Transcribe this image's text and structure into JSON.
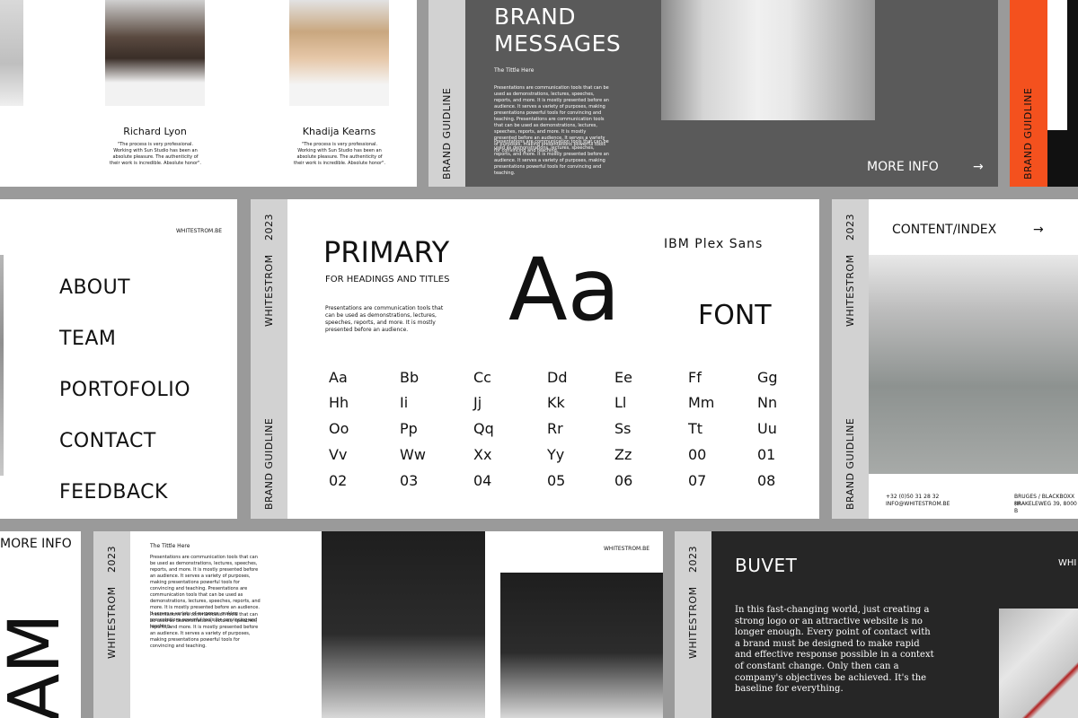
{
  "team_slide": {
    "members": [
      {
        "name": "Richard Lyon",
        "quote": "\"The process is very professional. Working with Sun Studio has been an absolute pleasure. The authenticity of their work is incredible. Absolute honor\"."
      },
      {
        "name": "Khadija Kearns",
        "quote": "\"The process is very professional. Working with Sun Studio has been an absolute pleasure. The authenticity of their work is incredible. Absolute honor\"."
      }
    ]
  },
  "brand_messages_slide": {
    "side_label": "BRAND GUIDLINE",
    "title_line1": "BRAND",
    "title_line2": "MESSAGES",
    "subtitle": "The Tittle Here",
    "para1": "Presentations are communication tools that can be used as demonstrations, lectures, speeches, reports, and more. It is mostly presented before an audience. It serves a variety of purposes, making presentations powerful tools for convincing and teaching. Presentations are communication tools that can be used as demonstrations, lectures, speeches, reports, and more. It is mostly presented before an audience. It serves a variety of purposes, making presentations powerful tools for convincing and teaching.",
    "para2": "Presentations are communication tools that can be used as demonstrations, lectures, speeches, reports, and more. It is mostly presented before an audience. It serves a variety of purposes, making presentations powerful tools for convincing and teaching.",
    "more_info": "MORE INFO",
    "arrow": "→"
  },
  "orange_slide": {
    "side_label": "BRAND GUIDLINE",
    "accent": "#f4511e"
  },
  "menu_slide": {
    "website": "WHITESTROM.BE",
    "items": [
      "ABOUT",
      "TEAM",
      "PORTOFOLIO",
      "CONTACT",
      "FEEDBACK"
    ]
  },
  "font_slide": {
    "year": "2023",
    "brand": "WHITESTROM",
    "side_label": "BRAND GUIDLINE",
    "primary": "PRIMARY",
    "sub": "FOR HEADINGS AND TITLES",
    "desc": "Presentations are communication tools that can be used as demonstrations, lectures, speeches, reports, and more. It is mostly presented before an audience.",
    "sample": "Aa",
    "font_name": "IBM Plex Sans",
    "font_word": "FONT",
    "glyph_rows": [
      [
        "Aa",
        "Bb",
        "Cc",
        "Dd",
        "Ee",
        "Ff",
        "Gg"
      ],
      [
        "Hh",
        "Ii",
        "Jj",
        "Kk",
        "Ll",
        "Mm",
        "Nn"
      ],
      [
        "Oo",
        "Pp",
        "Qq",
        "Rr",
        "Ss",
        "Tt",
        "Uu"
      ],
      [
        "Vv",
        "Ww",
        "Xx",
        "Yy",
        "Zz",
        "00",
        "01"
      ],
      [
        "02",
        "03",
        "04",
        "05",
        "06",
        "07",
        "08"
      ]
    ]
  },
  "index_slide": {
    "year": "2023",
    "brand": "WHITESTROM",
    "side_label": "BRAND GUIDLINE",
    "title": "CONTENT/INDEX",
    "arrow": "→",
    "phone": "+32 (0)50 31 28 32",
    "email": "INFO@WHITESTROM.BE",
    "address1": "BRUGES / BLACKBOXX (H",
    "address2": "KRAKELEWEG 39, 8000 B"
  },
  "bottom_left_slide": {
    "more_info": "MORE INFO",
    "big_letters": "AM"
  },
  "text_photo_slide": {
    "year": "2023",
    "brand": "WHITESTROM",
    "subtitle": "The Tittle Here",
    "website": "WHITESTROM.BE",
    "para1": "Presentations are communication tools that can be used as demonstrations, lectures, speeches, reports, and more. It is mostly presented before an audience. It serves a variety of purposes, making presentations powerful tools for convincing and teaching. Presentations are communication tools that can be used as demonstrations, lectures, speeches, reports, and more. It is mostly presented before an audience. It serves a variety of purposes, making presentations powerful tools for convincing and teaching.",
    "para2": "Presentations are communication tools that can be used as demonstrations, lectures, speeches, reports, and more. It is mostly presented before an audience. It serves a variety of purposes, making presentations powerful tools for convincing and teaching."
  },
  "buvet_slide": {
    "year": "2023",
    "brand": "WHITESTROM",
    "title": "BUVET",
    "corner": "WHI",
    "body": "In this fast-changing world, just creating a strong logo or an attractive website is no longer enough. Every point of contact with a brand must be designed to make rapid and effective response possible in a context of constant change. Only then can a company's objectives be achieved. It's the baseline for everything."
  }
}
